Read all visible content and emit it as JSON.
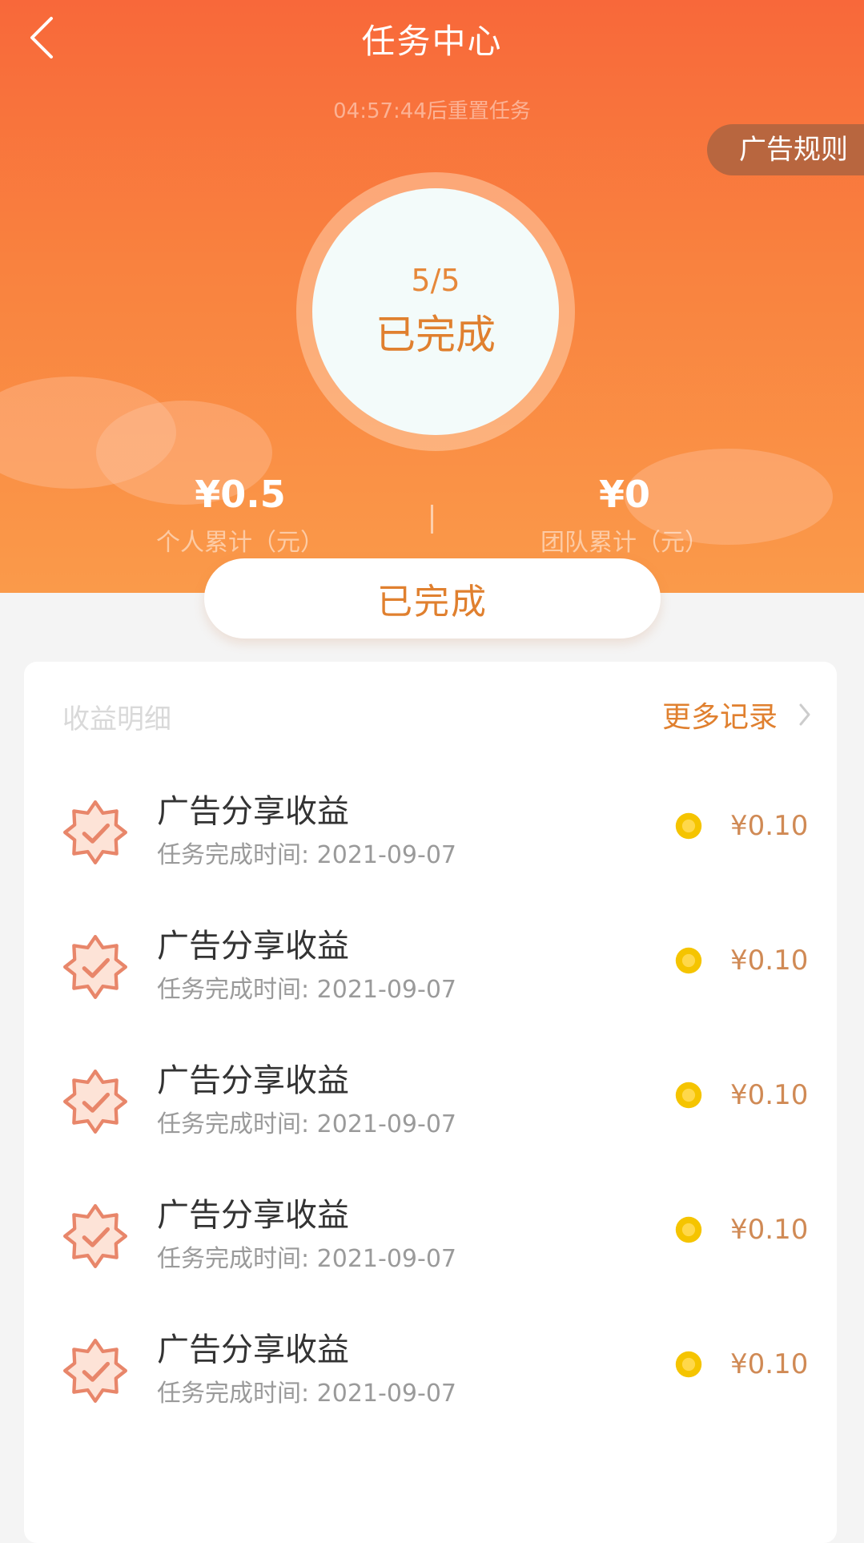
{
  "header": {
    "title": "任务中心",
    "subtitle": "04:57:44后重置任务",
    "rules_label": "广告规则"
  },
  "progress": {
    "count": "5/5",
    "label": "已完成"
  },
  "stats": [
    {
      "value": "¥0.5",
      "label": "个人累计（元）"
    },
    {
      "value": "¥0",
      "label": "团队累计（元）"
    }
  ],
  "status_pill": "已完成",
  "records_section": {
    "title": "收益明细",
    "more_label": "更多记录"
  },
  "records": [
    {
      "title": "广告分享收益",
      "time": "任务完成时间: 2021-09-07",
      "amount": "¥0.10"
    },
    {
      "title": "广告分享收益",
      "time": "任务完成时间: 2021-09-07",
      "amount": "¥0.10"
    },
    {
      "title": "广告分享收益",
      "time": "任务完成时间: 2021-09-07",
      "amount": "¥0.10"
    },
    {
      "title": "广告分享收益",
      "time": "任务完成时间: 2021-09-07",
      "amount": "¥0.10"
    },
    {
      "title": "广告分享收益",
      "time": "任务完成时间: 2021-09-07",
      "amount": "¥0.10"
    }
  ],
  "icons": {
    "back": "chevron-left-icon",
    "more": "chevron-right-icon",
    "record": "check-badge-icon",
    "coin": "coin-icon"
  },
  "colors": {
    "header_start": "#f8683a",
    "header_end": "#fa9a4a",
    "accent": "#e0802f",
    "rules_bg": "#b8663f",
    "coin": "#f5c400",
    "badge": "#e8866a"
  }
}
